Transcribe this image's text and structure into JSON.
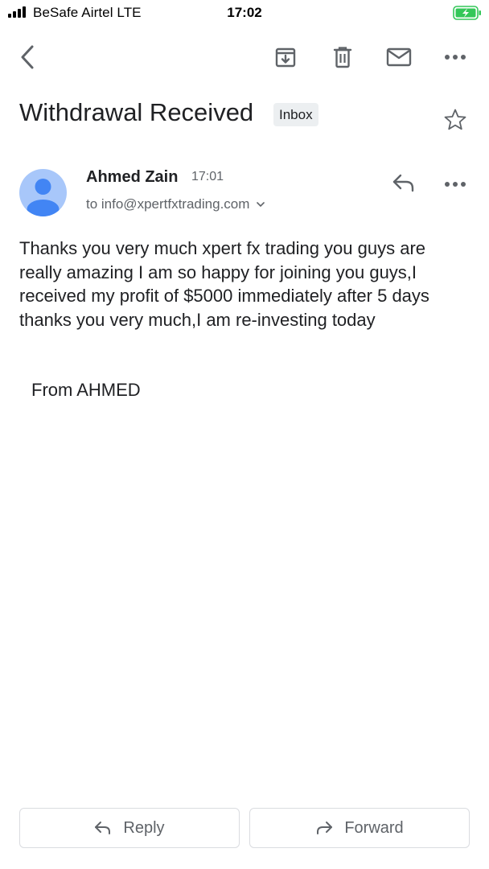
{
  "status_bar": {
    "carrier": "BeSafe Airtel  LTE",
    "time": "17:02",
    "battery_color": "#34c759"
  },
  "toolbar": {
    "icons": [
      "back-icon",
      "archive-icon",
      "delete-icon",
      "mark-unread-icon",
      "more-icon"
    ]
  },
  "email": {
    "subject": "Withdrawal Received",
    "label": "Inbox",
    "sender_name": "Ahmed Zain",
    "sent_time": "17:01",
    "recipient": "to info@xpertfxtrading.com",
    "body": "Thanks you very much xpert fx trading you guys are really amazing I am so happy for joining you guys,I received my profit of $5000 immediately after 5 days thanks you very much,I am re-investing today",
    "signature": "From AHMED"
  },
  "actions": {
    "reply_label": "Reply",
    "forward_label": "Forward"
  },
  "colors": {
    "avatar_bg": "#a8c7fa",
    "avatar_fg": "#4285f4",
    "chip_bg": "#eceff1",
    "icon_gray": "#5f6368"
  }
}
